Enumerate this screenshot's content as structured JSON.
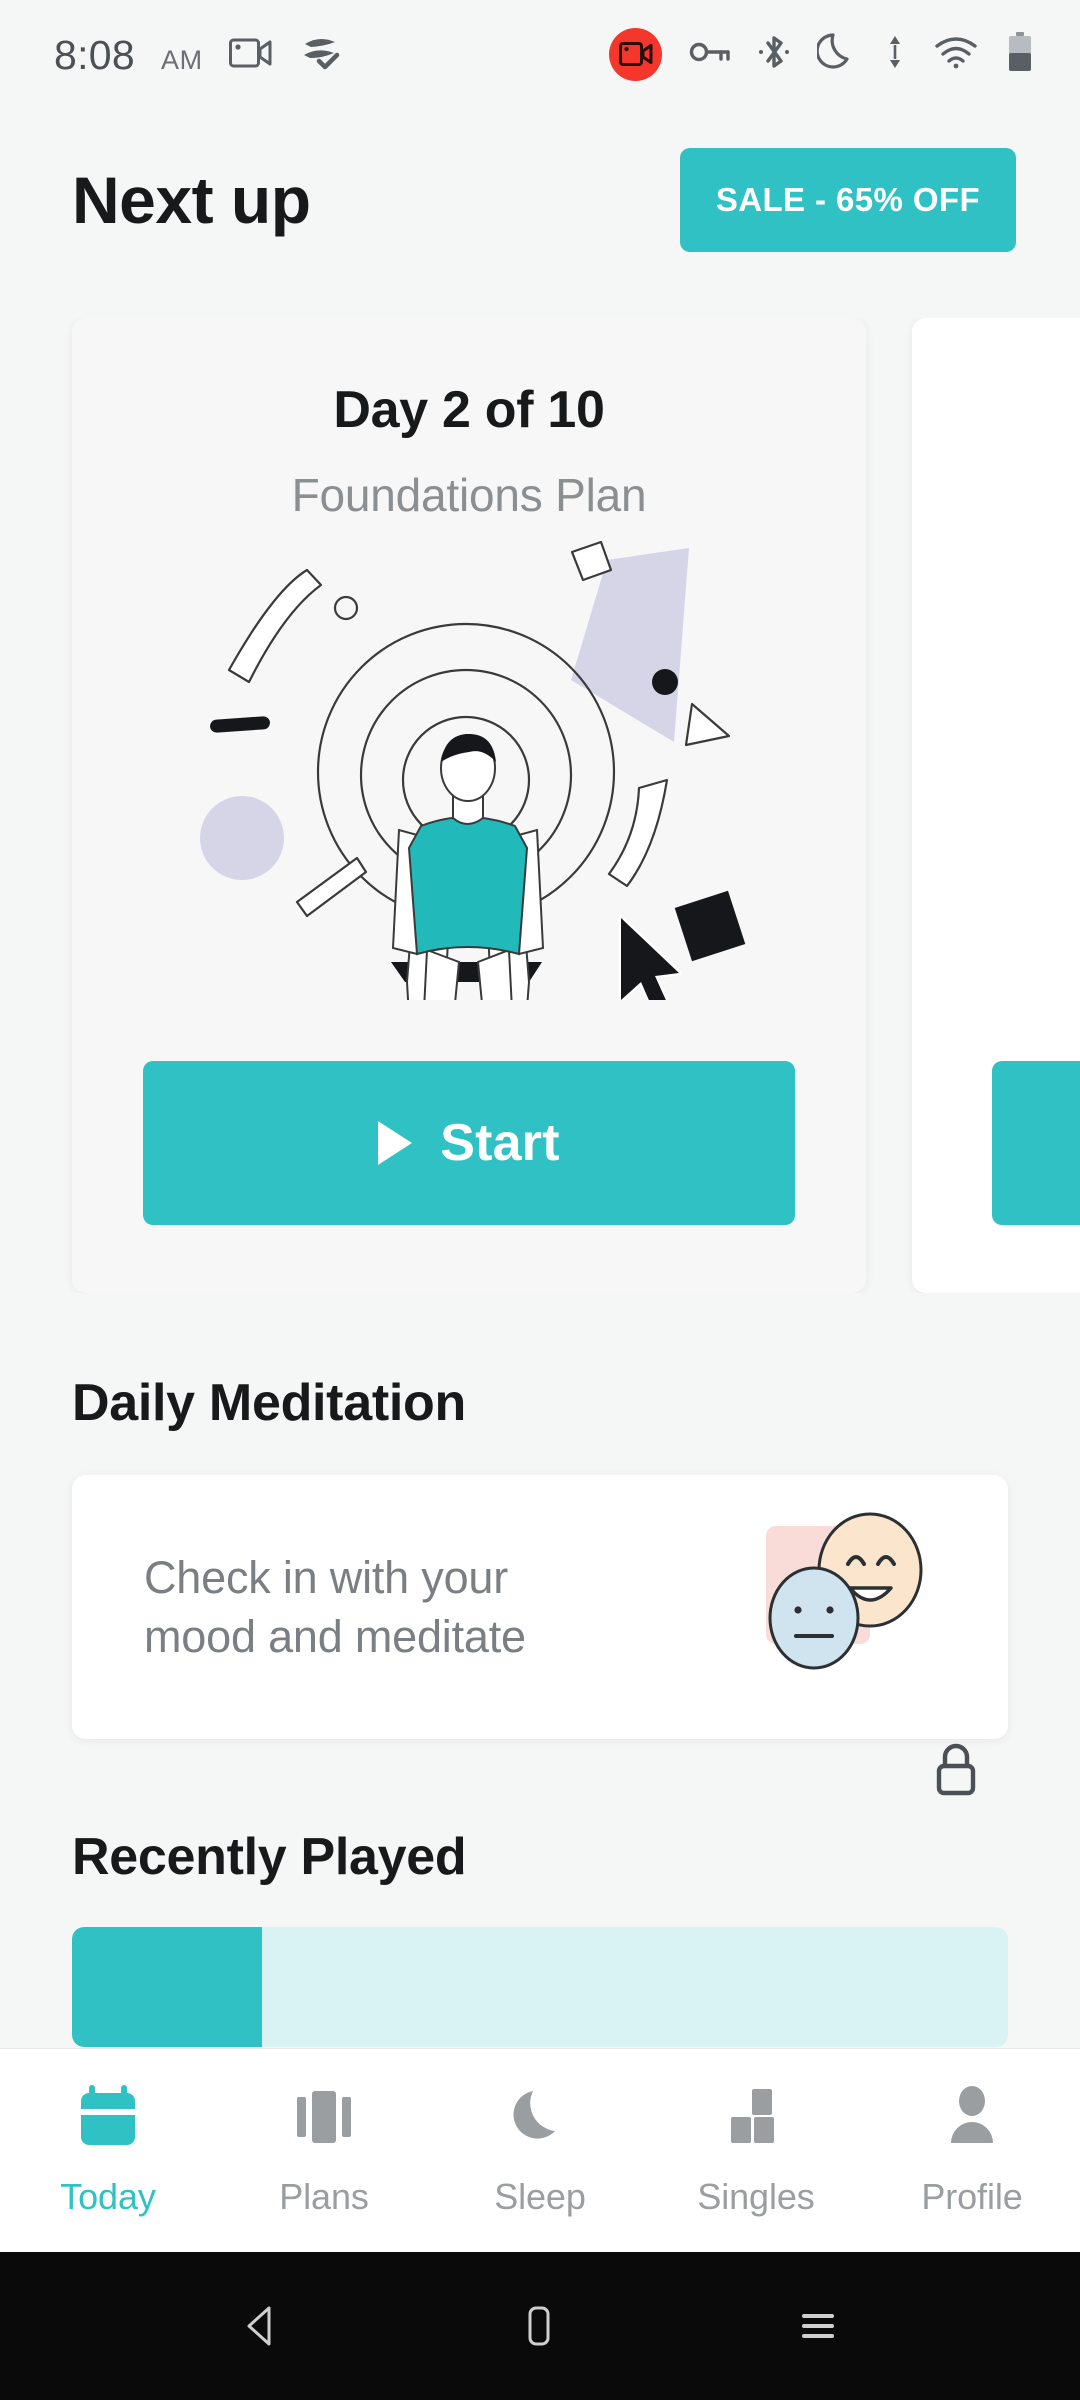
{
  "status_bar": {
    "time": "8:08",
    "am_pm": "AM",
    "left_icons": [
      "screen-record-camera-icon",
      "data-saver-check-icon"
    ],
    "right_icons": [
      "screen-recording-active-icon",
      "vpn-key-icon",
      "bluetooth-icon",
      "do-not-disturb-moon-icon",
      "data-transfer-arrows-icon",
      "wifi-icon",
      "battery-icon"
    ]
  },
  "header": {
    "title": "Next up",
    "sale_label": "SALE - 65% OFF"
  },
  "plan_card": {
    "day_label": "Day 2 of 10",
    "plan_name": "Foundations Plan",
    "start_label": "Start",
    "illustration": "seated-person-meditating-illustration",
    "cursor": "mouse-pointer-cursor"
  },
  "daily_meditation": {
    "section_title": "Daily Meditation",
    "card_text_line1": "Check in with your",
    "card_text_line2": "mood and meditate",
    "locked": true
  },
  "recently_played": {
    "section_title": "Recently Played"
  },
  "bottom_nav": {
    "items": [
      {
        "label": "Today",
        "icon": "calendar-icon",
        "active": true
      },
      {
        "label": "Plans",
        "icon": "columns-icon",
        "active": false
      },
      {
        "label": "Sleep",
        "icon": "moon-icon",
        "active": false
      },
      {
        "label": "Singles",
        "icon": "blocks-icon",
        "active": false
      },
      {
        "label": "Profile",
        "icon": "person-icon",
        "active": false
      }
    ]
  },
  "system_nav": {
    "back": "back-triangle-icon",
    "home": "home-square-icon",
    "recents": "recents-menu-icon"
  },
  "colors": {
    "accent_teal": "#2fc1c4",
    "page_background": "#f5f6f6",
    "card_background": "#f7f7f7",
    "white_card": "#ffffff",
    "record_red": "#f4362c",
    "muted_text": "#8b8f92",
    "title_text": "#17191a",
    "mood_pink": "#f9dcd8",
    "mood_cream": "#fbe6cd",
    "mood_blue": "#cfe4ef",
    "shirt_teal": "#22b9bb",
    "lavender": "#d6d5e8",
    "recent_light": "#d9f3f5"
  }
}
